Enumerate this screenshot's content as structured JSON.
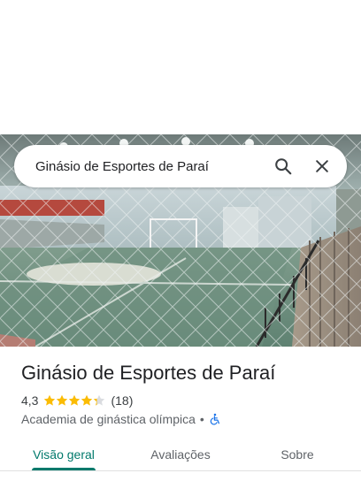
{
  "search": {
    "query": "Ginásio de Esportes de Paraí",
    "search_icon": "search-icon",
    "close_icon": "close-icon"
  },
  "place": {
    "name": "Ginásio de Esportes de Paraí",
    "rating": "4,3",
    "stars": 4.3,
    "reviews_count": "(18)",
    "category": "Academia de ginástica olímpica",
    "separator": "•",
    "accessibility_icon": "wheelchair-icon"
  },
  "tabs": [
    {
      "label": "Visão geral",
      "active": true
    },
    {
      "label": "Avaliações",
      "active": false
    },
    {
      "label": "Sobre",
      "active": false
    }
  ],
  "colors": {
    "accent": "#00796b",
    "star": "#fbbc04",
    "accessibility": "#1a73e8"
  }
}
